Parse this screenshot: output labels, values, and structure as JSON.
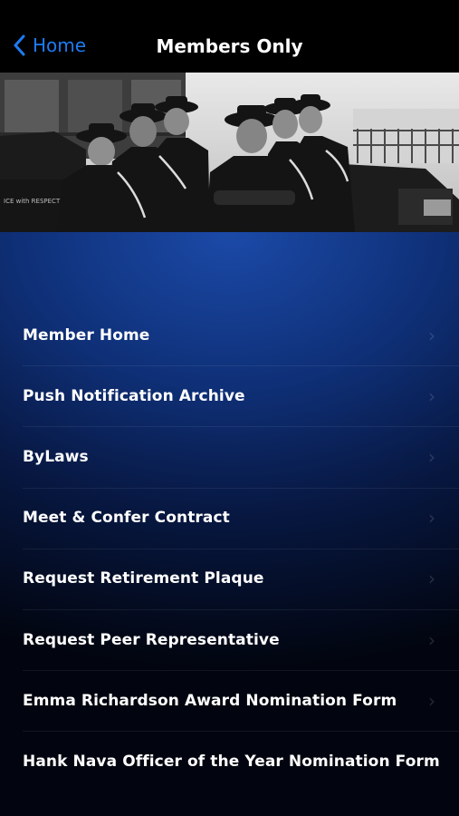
{
  "nav": {
    "back_label": "Home",
    "title": "Members Only"
  },
  "hero": {
    "image_text": "ICE with RESPECT"
  },
  "menu": {
    "items": [
      {
        "label": "Member Home"
      },
      {
        "label": "Push Notification Archive"
      },
      {
        "label": "ByLaws"
      },
      {
        "label": "Meet & Confer Contract"
      },
      {
        "label": "Request Retirement Plaque"
      },
      {
        "label": "Request Peer Representative"
      },
      {
        "label": "Emma Richardson Award Nomination Form"
      },
      {
        "label": "Hank Nava Officer of the Year Nomination Form"
      }
    ],
    "chevron_icon": "chevron-right-icon"
  },
  "colors": {
    "accent": "#1d7cf2",
    "nav_bg": "#000000",
    "menu_gradient_top": "#1b4aa8",
    "menu_gradient_bottom": "#02050f",
    "text": "#ffffff"
  }
}
